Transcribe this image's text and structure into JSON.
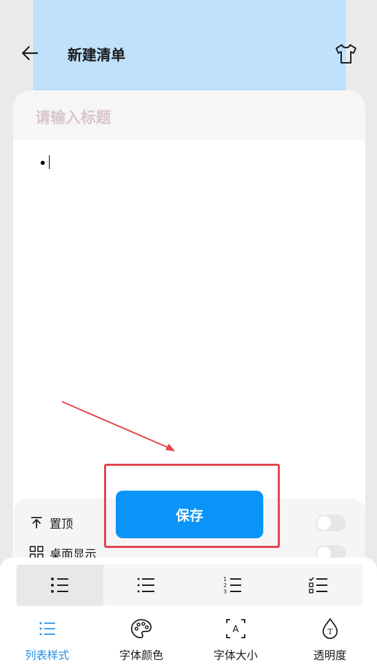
{
  "header": {
    "title": "新建清单"
  },
  "card": {
    "title_placeholder": "请输入标题"
  },
  "options": [
    {
      "label": "置顶",
      "icon": "pin-top-icon"
    },
    {
      "label": "桌面显示",
      "icon": "desktop-widget-icon"
    }
  ],
  "save": {
    "label": "保存"
  },
  "list_styles": [
    "bullet-list-icon",
    "dot-list-icon",
    "numbered-list-icon",
    "checklist-icon"
  ],
  "tabs": [
    {
      "label": "列表样式",
      "icon": "list-style-icon"
    },
    {
      "label": "字体颜色",
      "icon": "palette-icon"
    },
    {
      "label": "字体大小",
      "icon": "font-size-icon"
    },
    {
      "label": "透明度",
      "icon": "opacity-icon"
    }
  ],
  "colors": {
    "accent": "#0a94f8",
    "highlight": "#e3434a",
    "header_bg": "#bfe1fb",
    "active_tab": "#1e90e8"
  }
}
